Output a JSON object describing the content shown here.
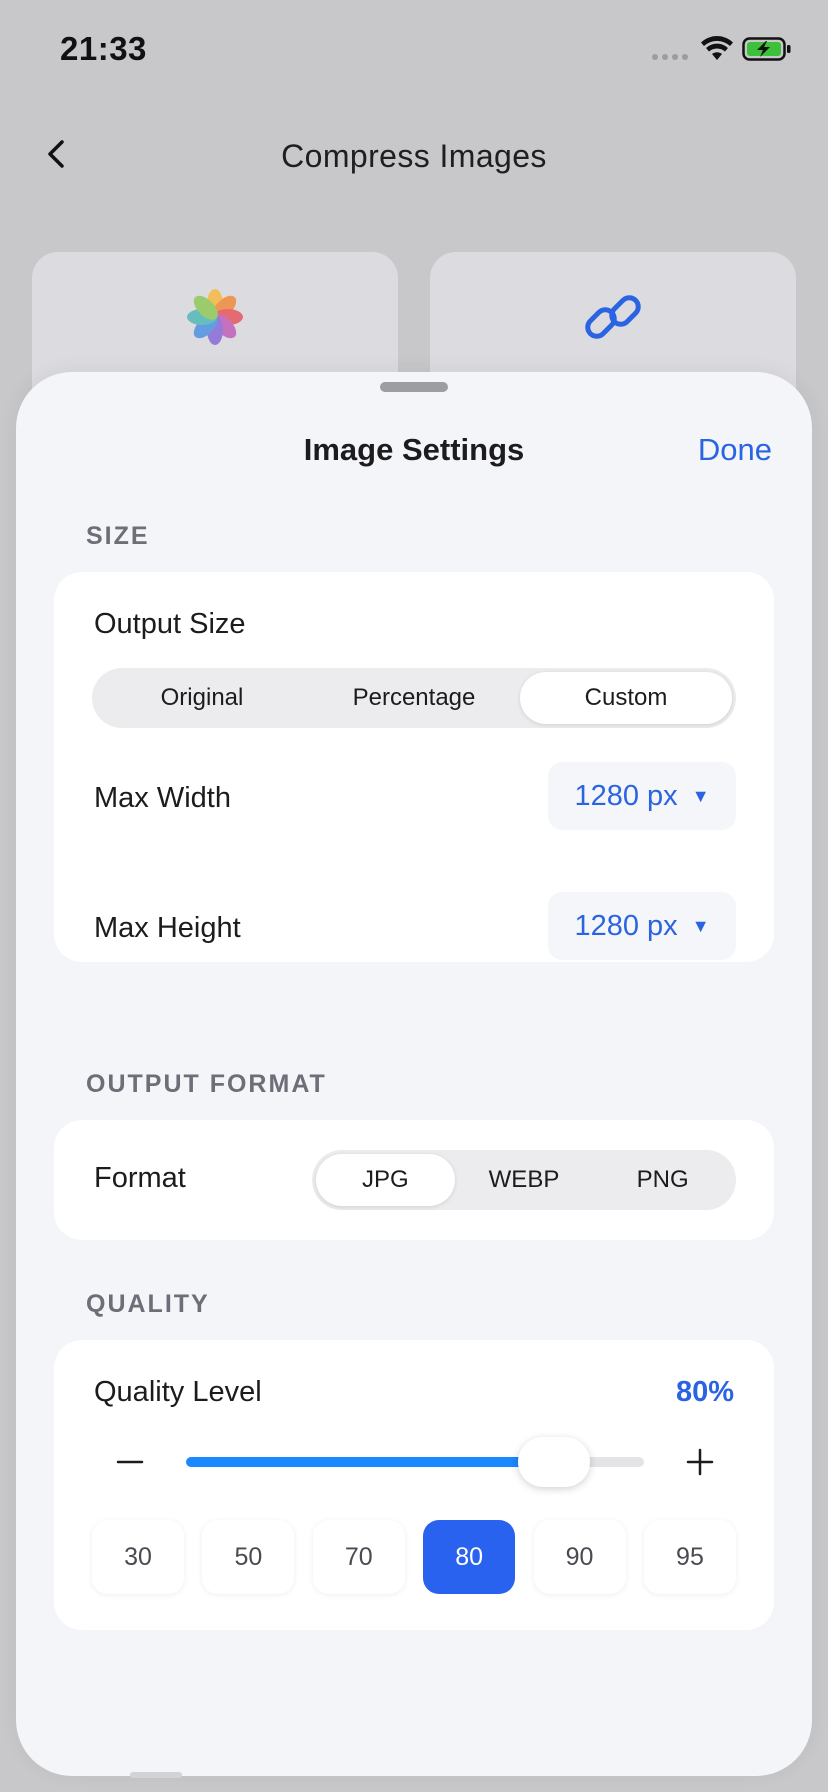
{
  "status_bar": {
    "time": "21:33"
  },
  "nav": {
    "title": "Compress Images"
  },
  "sheet": {
    "title": "Image Settings",
    "done_label": "Done",
    "sections": {
      "size": "SIZE",
      "format": "OUTPUT FORMAT",
      "quality": "QUALITY"
    }
  },
  "size": {
    "output_size_label": "Output Size",
    "options": [
      "Original",
      "Percentage",
      "Custom"
    ],
    "selected_option": "Custom",
    "max_width_label": "Max Width",
    "max_width_value": "1280 px",
    "max_height_label": "Max Height",
    "max_height_value": "1280 px"
  },
  "format": {
    "label": "Format",
    "options": [
      "JPG",
      "WEBP",
      "PNG"
    ],
    "selected": "JPG"
  },
  "quality": {
    "label": "Quality Level",
    "value_text": "80%",
    "value": 80,
    "min": 0,
    "max": 100,
    "presets": [
      "30",
      "50",
      "70",
      "80",
      "90",
      "95"
    ],
    "active_preset": "80"
  },
  "colors": {
    "accent": "#2b64e3",
    "slider_fill": "#1a88ff",
    "preset_active": "#2a62f0",
    "battery_green": "#3cc13b"
  }
}
